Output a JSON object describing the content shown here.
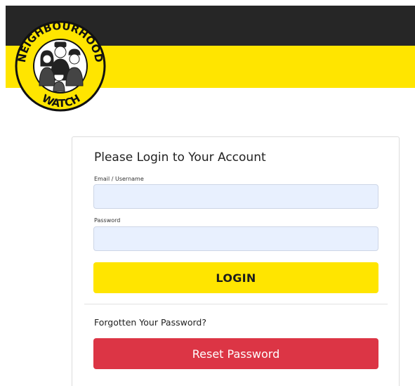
{
  "brand": {
    "logo_text_top": "NEIGHBOURHOOD",
    "logo_text_bottom": "WATCH",
    "logo_icon": "neighbourhood-watch-logo",
    "colors": {
      "yellow": "#ffe500",
      "dark": "#262626",
      "danger": "#dc3545"
    }
  },
  "login_form": {
    "title": "Please Login to Your Account",
    "email_label": "Email / Username",
    "email_value": "",
    "password_label": "Password",
    "password_value": "",
    "login_label": "LOGIN"
  },
  "reset": {
    "prompt": "Forgotten Your Password?",
    "button_label": "Reset Password"
  }
}
